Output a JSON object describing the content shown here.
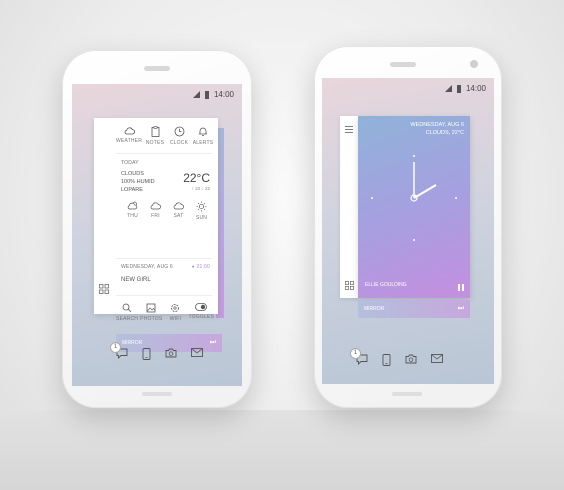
{
  "status": {
    "time": "14:00"
  },
  "phone_left": {
    "quick_icons": [
      {
        "label": "WEATHER",
        "icon": "cloud-icon"
      },
      {
        "label": "NOTES",
        "icon": "clipboard-icon"
      },
      {
        "label": "CLOCK",
        "icon": "clock-icon"
      },
      {
        "label": "ALERTS",
        "icon": "bell-icon"
      }
    ],
    "weather": {
      "section_label": "TODAY",
      "condition": "CLOUDS",
      "humidity": "100% HUMID",
      "place": "LOPARE",
      "temperature": "22°C",
      "range": "↑ 22  ↓ 22",
      "forecast": [
        {
          "day": "THU",
          "icon": "partly-cloudy-icon"
        },
        {
          "day": "FRI",
          "icon": "cloud-icon"
        },
        {
          "day": "SAT",
          "icon": "cloud-icon"
        },
        {
          "day": "SUN",
          "icon": "sun-icon"
        }
      ]
    },
    "event": {
      "date": "WEDNESDAY, AUG 6",
      "time": "● 21:00",
      "title": "NEW GIRL"
    },
    "tools": [
      {
        "label": "SEARCH",
        "icon": "search-icon"
      },
      {
        "label": "PHOTOS",
        "icon": "image-icon"
      },
      {
        "label": "WIFI",
        "icon": "settings-icon"
      },
      {
        "label": "TOGGLES",
        "icon": "toggle-icon"
      }
    ],
    "mirror_label": "MIRROR"
  },
  "phone_right": {
    "header_line1": "WEDNESDAY, AUG 6",
    "header_line2": "CLOUDS, 22°C",
    "song": "ELLIE GOULDING",
    "mirror_label": "MIRROR"
  },
  "dock_badge": "1",
  "colors": {
    "gradient_start": "#8fb3d9",
    "gradient_end": "#c58fe0",
    "accent": "#b98ce3"
  }
}
